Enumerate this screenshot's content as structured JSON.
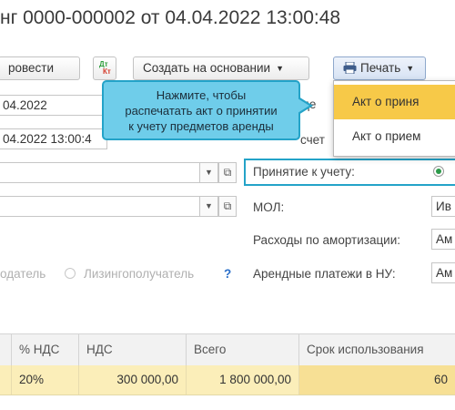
{
  "document": {
    "title": "нг 0000-000002 от 04.04.2022 13:00:48"
  },
  "toolbar": {
    "post_label": "ровести",
    "dtkt_top": "Дт",
    "dtkt_bottom": "Кт",
    "create_based_label": "Создать на основании",
    "print_label": "Печать"
  },
  "print_menu": {
    "items": [
      "Акт о приня",
      "Акт о прием"
    ]
  },
  "tooltip": {
    "text_line1": "Нажмите, чтобы",
    "text_line2": "распечатать акт о принятии",
    "text_line3": "к учету предметов аренды"
  },
  "form": {
    "date_value": "04.2022",
    "datetime_value": "04.2022 13:00:4",
    "partial_label_top": "де",
    "partial_label_mid": "счет",
    "acceptance_label": "Принятие к учету:",
    "mol_label": "МОЛ:",
    "mol_value": "Ив",
    "depreciation_label": "Расходы по амортизации:",
    "depreciation_value": "Ам",
    "lease_payments_label": "Арендные платежи в НУ:",
    "lease_payments_value": "Ам",
    "role_left_label": "одатель",
    "role_right_label": "Лизингополучатель",
    "help_mark": "?"
  },
  "table": {
    "columns": [
      "",
      "% НДС",
      "НДС",
      "Всего",
      "Срок использования"
    ],
    "rows": [
      {
        "vat_rate": "20%",
        "vat": "300 000,00",
        "total": "1 800 000,00",
        "term": "60"
      }
    ]
  },
  "colors": {
    "accent": "#24a3c8",
    "tooltip_bg": "#6fcdea",
    "menu_active": "#f7c948",
    "row_selected": "#fbeeb9"
  }
}
